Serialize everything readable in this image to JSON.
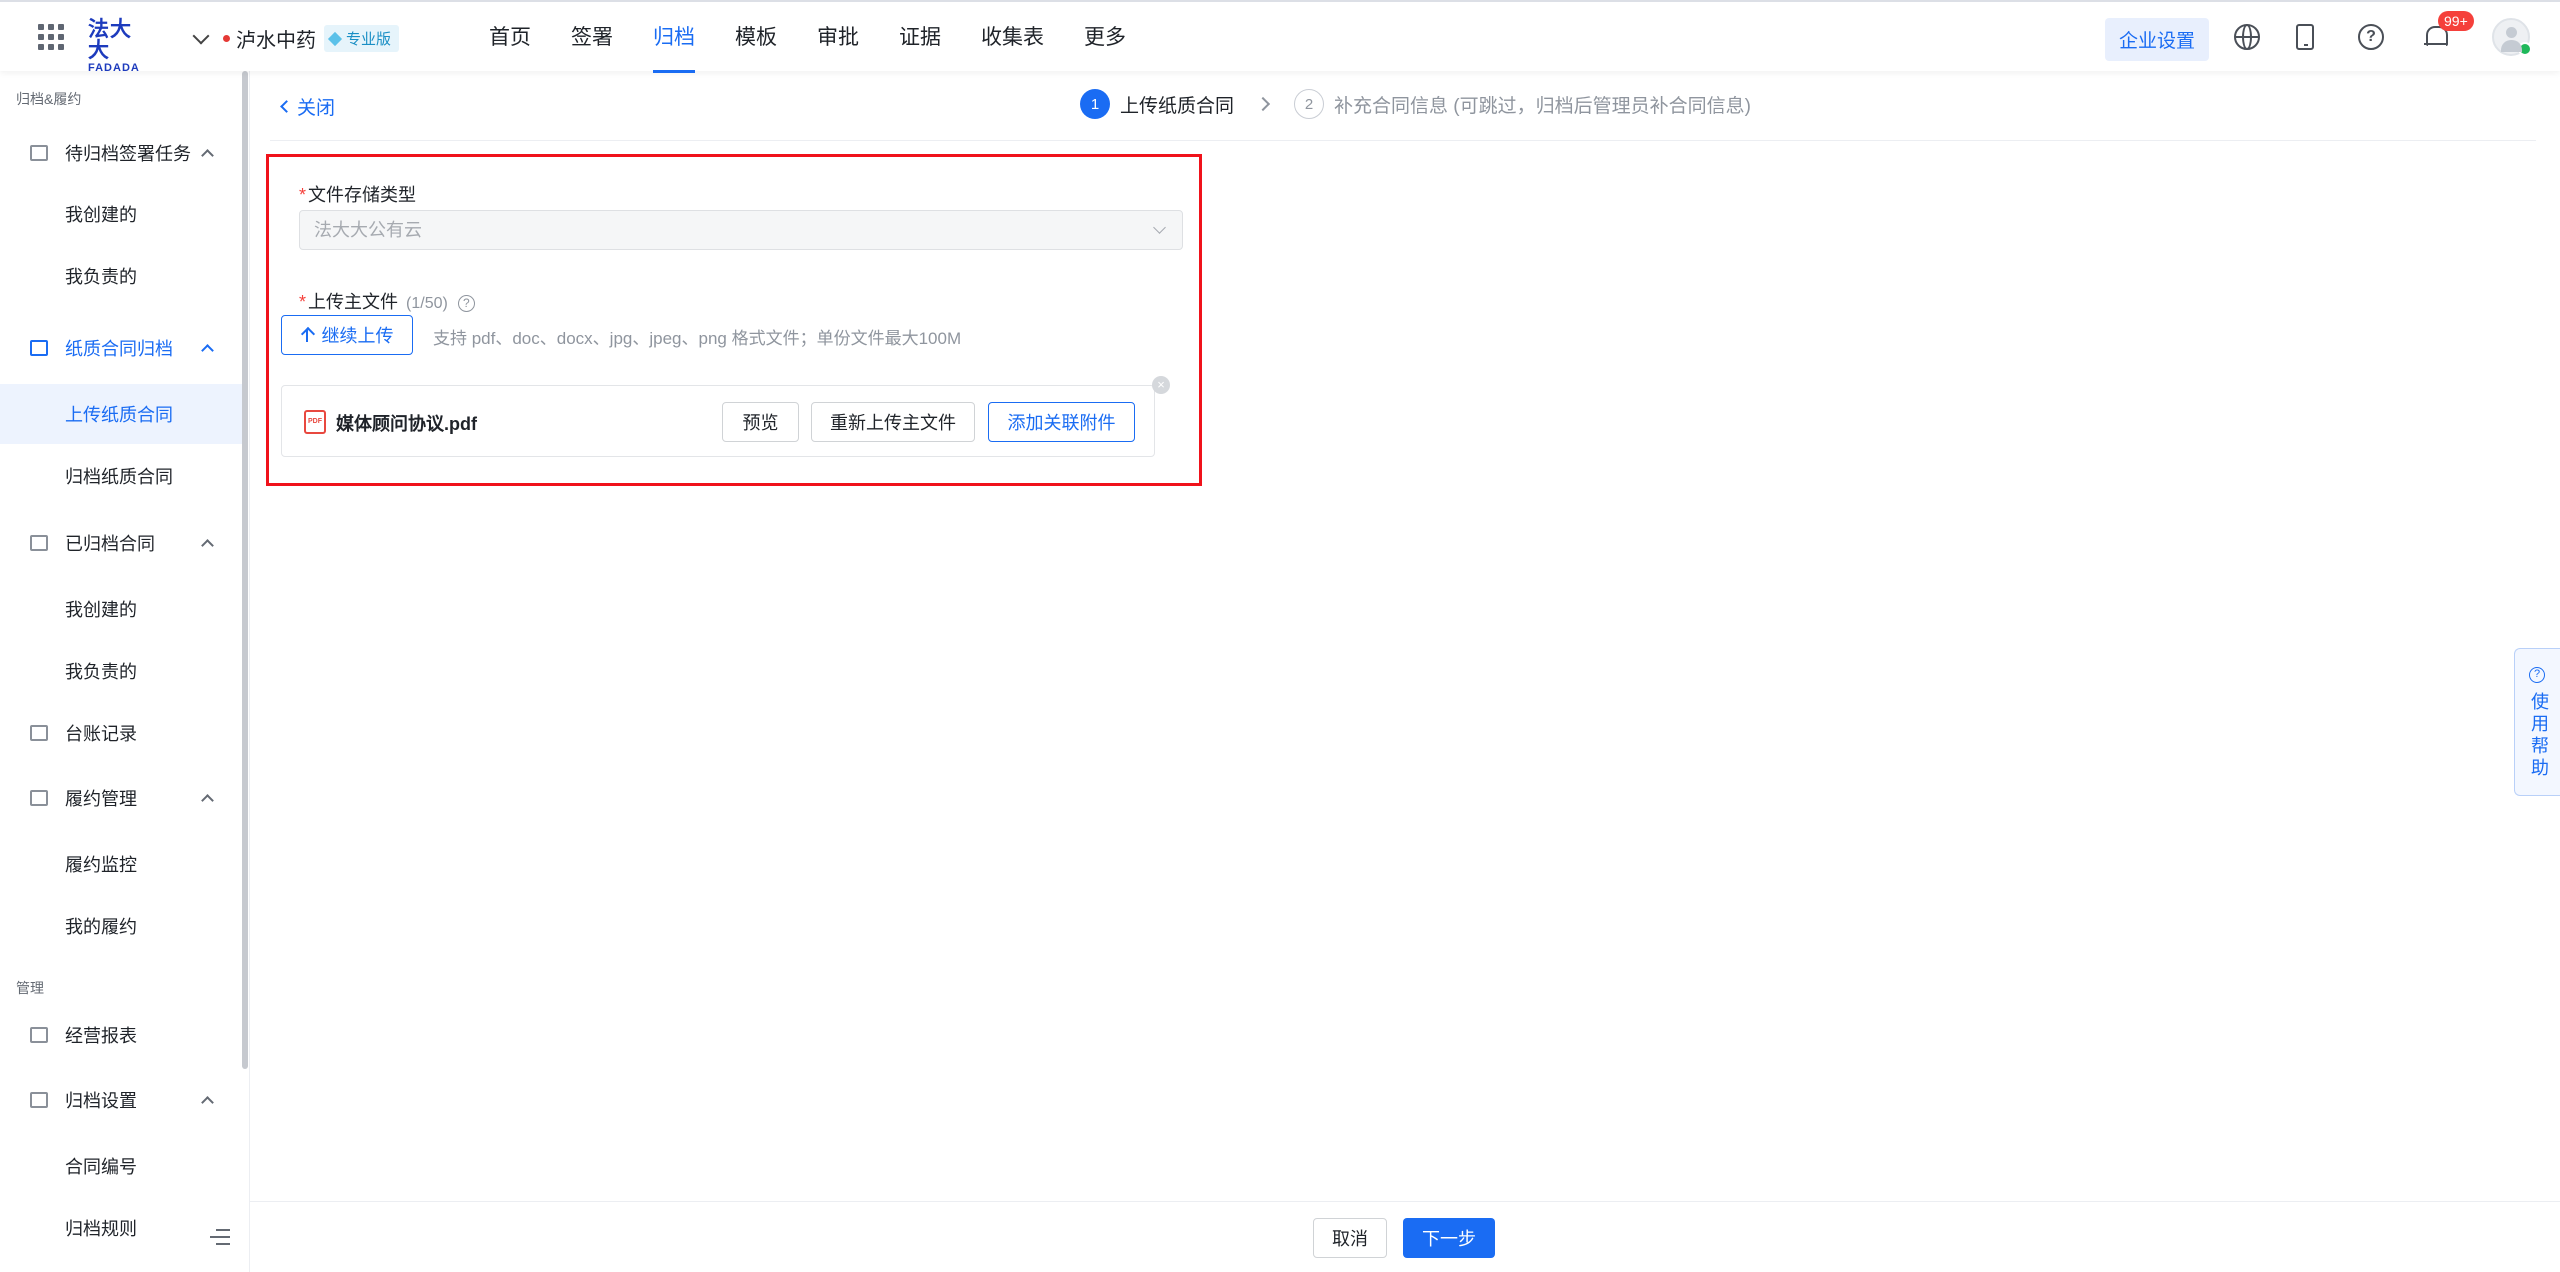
{
  "header": {
    "logo_cn": "法大大",
    "logo_en": "FADADA",
    "org_name": "泸水中药",
    "edition_badge": "专业版",
    "nav": [
      "首页",
      "签署",
      "归档",
      "模板",
      "审批",
      "证据",
      "收集表",
      "更多"
    ],
    "active_nav": "归档",
    "enterprise_settings": "企业设置",
    "notification_count": "99+"
  },
  "sidebar": {
    "group1_title": "归档&履约",
    "pending": "待归档签署任务",
    "pending_created": "我创建的",
    "pending_responsible": "我负责的",
    "paper": "纸质合同归档",
    "paper_upload": "上传纸质合同",
    "paper_archive": "归档纸质合同",
    "archived": "已归档合同",
    "archived_created": "我创建的",
    "archived_responsible": "我负责的",
    "ledger": "台账记录",
    "perf": "履约管理",
    "perf_monitor": "履约监控",
    "perf_mine": "我的履约",
    "group2_title": "管理",
    "reports": "经营报表",
    "archive_settings": "归档设置",
    "contract_no": "合同编号",
    "archive_rules": "归档规则"
  },
  "page": {
    "close": "关闭",
    "step1_num": "1",
    "step1": "上传纸质合同",
    "step2_num": "2",
    "step2": "补充合同信息 (可跳过，归档后管理员补合同信息)"
  },
  "form": {
    "storage_label": "文件存储类型",
    "storage_value": "法大大公有云",
    "upload_label": "上传主文件",
    "upload_count": "(1/50)",
    "continue_upload": "继续上传",
    "upload_hint": "支持 pdf、doc、docx、jpg、jpeg、png 格式文件；单份文件最大100M",
    "file_name": "媒体顾问协议.pdf",
    "preview": "预览",
    "reupload": "重新上传主文件",
    "add_attachment": "添加关联附件"
  },
  "footer": {
    "cancel": "取消",
    "next": "下一步"
  },
  "help": {
    "label": "使用帮助"
  },
  "colors": {
    "primary": "#1a6cf3",
    "highlight_border": "#f0121b",
    "badge_red": "#f5403b"
  }
}
